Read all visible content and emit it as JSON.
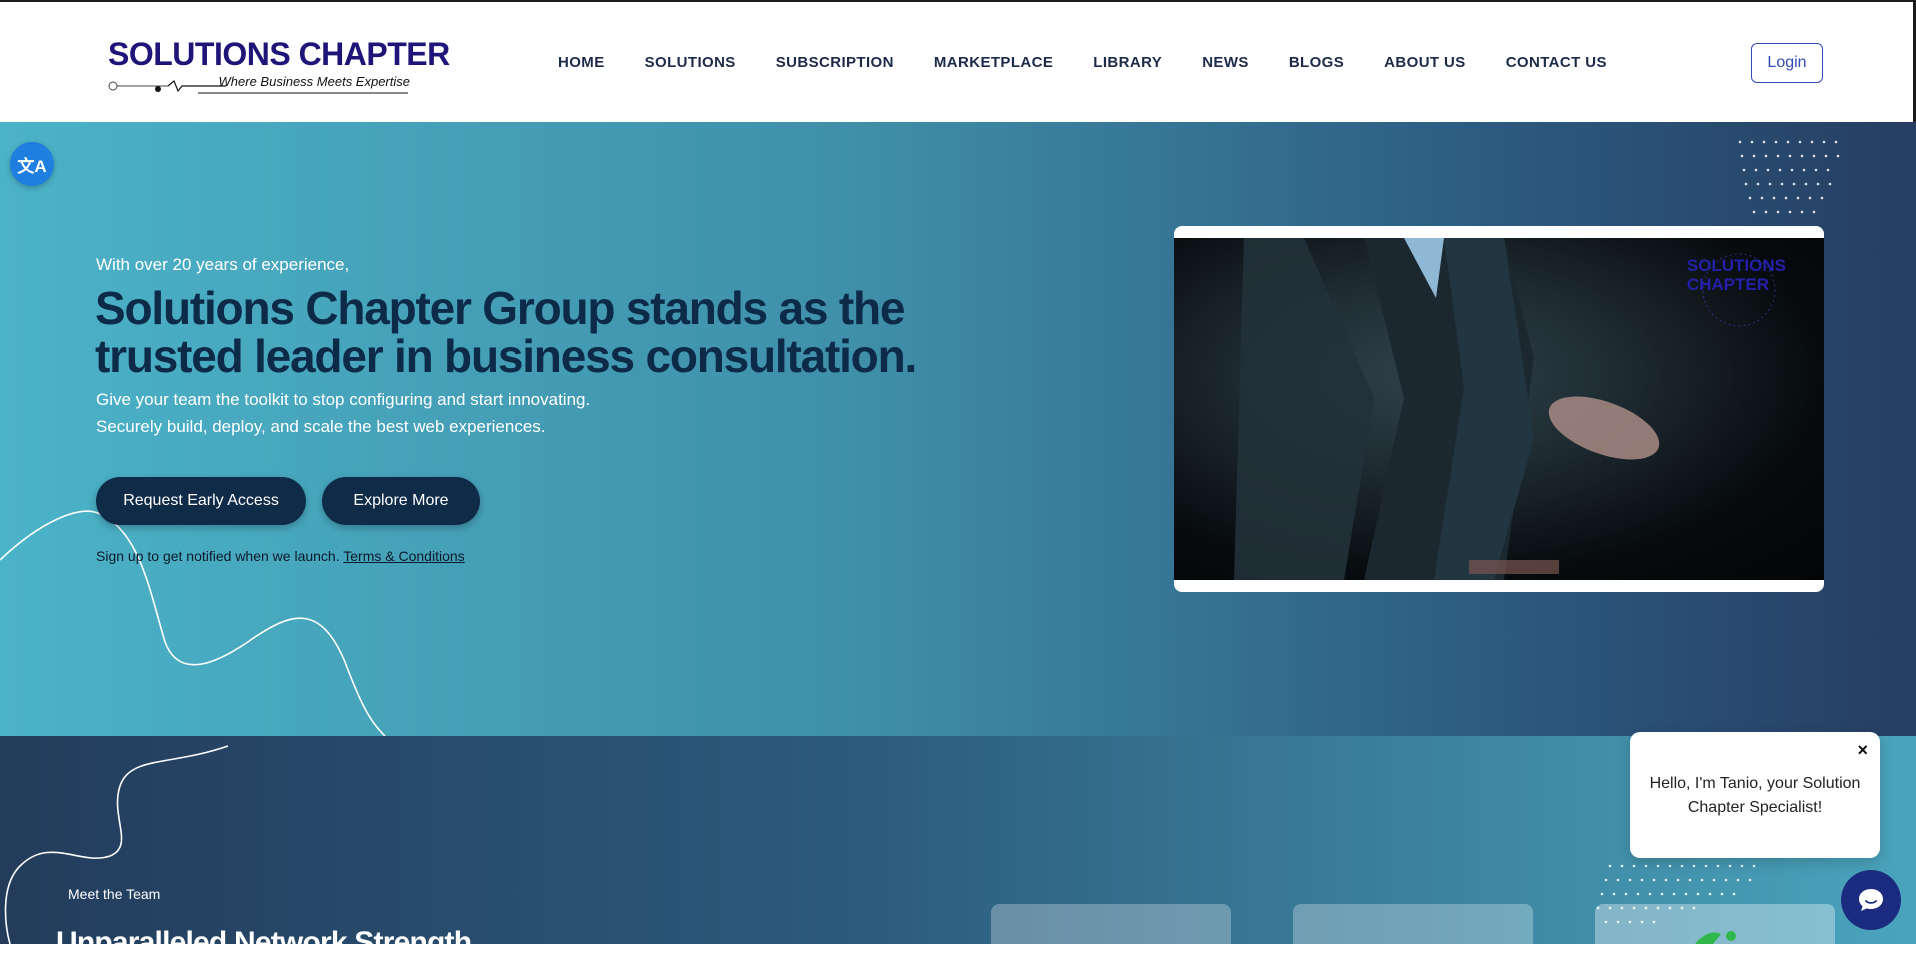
{
  "header": {
    "logo_title": "SOLUTIONS CHAPTER",
    "logo_tagline": "Where Business Meets Expertise",
    "nav": [
      "HOME",
      "SOLUTIONS",
      "SUBSCRIPTION",
      "MARKETPLACE",
      "LIBRARY",
      "NEWS",
      "BLOGS",
      "ABOUT US",
      "CONTACT US"
    ],
    "login_label": "Login"
  },
  "hero": {
    "eyebrow": "With over 20 years of experience,",
    "headline": "Solutions Chapter Group stands as the trusted leader in business consultation.",
    "sub_line1": "Give your team the toolkit to stop configuring and start innovating.",
    "sub_line2": "Securely build, deploy, and scale the best web experiences.",
    "cta_primary": "Request Early Access",
    "cta_secondary": "Explore More",
    "notice_text": "Sign up to get notified when we launch.",
    "notice_link": "Terms & Conditions",
    "video_brand_line1": "SOLUTIONS",
    "video_brand_line2": "CHAPTER"
  },
  "team": {
    "label": "Meet the Team",
    "title": "Unparalleled Network Strength"
  },
  "chat": {
    "message": "Hello, I'm Tanio, your Solution Chapter Specialist!",
    "close_glyph": "×"
  },
  "icons": {
    "translate": "translate-icon",
    "chat": "chat-bubble-icon",
    "close": "close-icon"
  },
  "colors": {
    "brand_navy": "#1f1578",
    "button_dark": "#0f2b48",
    "login_blue": "#2f4bb5",
    "chat_blue": "#1b2c80"
  }
}
